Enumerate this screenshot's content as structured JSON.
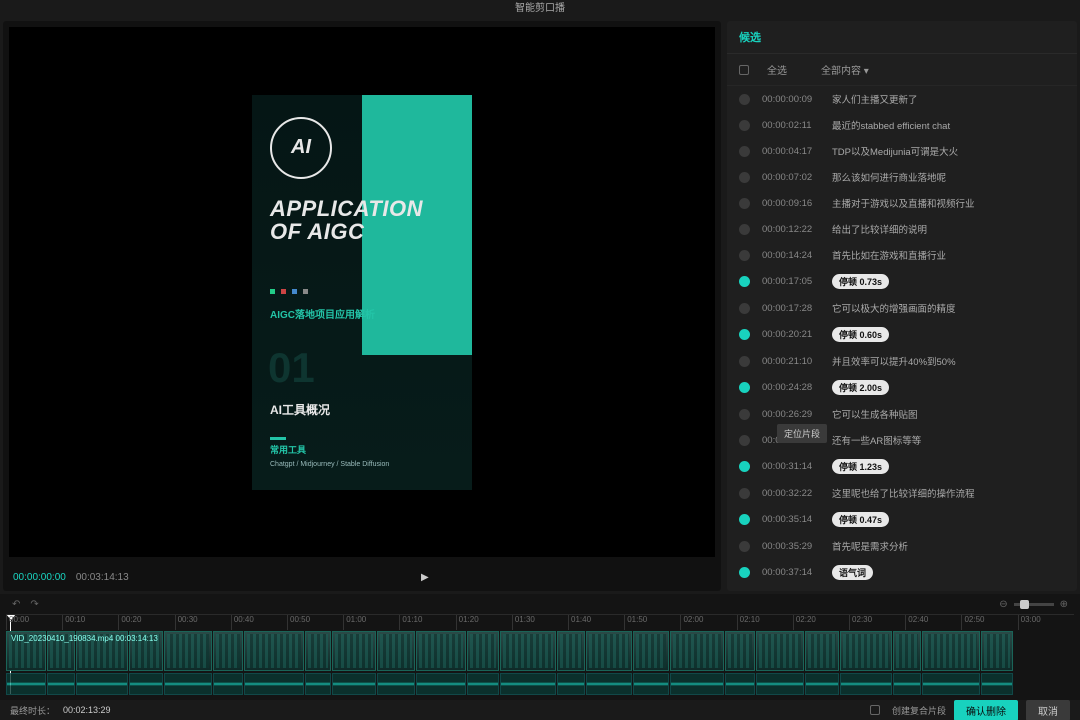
{
  "title": "智能剪口播",
  "preview": {
    "time_current": "00:00:00:00",
    "time_total": "00:03:14:13",
    "slide": {
      "badge": "AI",
      "heading": "APPLICATION OF AIGC",
      "sub1": "AIGC落地项目应用解析",
      "num": "01",
      "sub2": "AI工具概况",
      "sub3": "常用工具",
      "sub4": "Chatgpt / Midjourney / Stable Diffusion"
    }
  },
  "sidebar": {
    "title": "候选",
    "select_all": "全选",
    "filter": "全部内容",
    "tooltip": "定位片段",
    "items": [
      {
        "on": false,
        "ts": "00:00:00:09",
        "txt": "家人们主播又更新了"
      },
      {
        "on": false,
        "ts": "00:00:02:11",
        "txt": "最近的stabbed efficient chat"
      },
      {
        "on": false,
        "ts": "00:00:04:17",
        "txt": "TDP以及Medijunia可谓是大火"
      },
      {
        "on": false,
        "ts": "00:00:07:02",
        "txt": "那么该如何进行商业落地呢"
      },
      {
        "on": false,
        "ts": "00:00:09:16",
        "txt": "主播对于游戏以及直播和视频行业"
      },
      {
        "on": false,
        "ts": "00:00:12:22",
        "txt": "给出了比较详细的说明"
      },
      {
        "on": false,
        "ts": "00:00:14:24",
        "txt": "首先比如在游戏和直播行业"
      },
      {
        "on": true,
        "ts": "00:00:17:05",
        "pill": "停顿 0.73s"
      },
      {
        "on": false,
        "ts": "00:00:17:28",
        "txt": "它可以极大的增强画面的精度"
      },
      {
        "on": true,
        "ts": "00:00:20:21",
        "pill": "停顿 0.60s"
      },
      {
        "on": false,
        "ts": "00:00:21:10",
        "txt": "并且效率可以提升40%到50%"
      },
      {
        "on": true,
        "ts": "00:00:24:28",
        "pill": "停顿 2.00s"
      },
      {
        "on": false,
        "ts": "00:00:26:29",
        "txt": "它可以生成各种贴图"
      },
      {
        "on": false,
        "ts": "00:00:29:06",
        "txt": "还有一些AR图标等等",
        "tip": true
      },
      {
        "on": true,
        "ts": "00:00:31:14",
        "pill": "停顿 1.23s"
      },
      {
        "on": false,
        "ts": "00:00:32:22",
        "txt": "这里呢也给了比较详细的操作流程"
      },
      {
        "on": true,
        "ts": "00:00:35:14",
        "pill": "停顿 0.47s"
      },
      {
        "on": false,
        "ts": "00:00:35:29",
        "txt": "首先呢是需求分析"
      },
      {
        "on": true,
        "ts": "00:00:37:14",
        "pill": "语气词"
      }
    ]
  },
  "timeline": {
    "clip_label": "VID_20230410_190834.mp4   00:03:14:13",
    "ticks": [
      "00:00",
      "00:10",
      "00:20",
      "00:30",
      "00:40",
      "00:50",
      "01:00",
      "01:10",
      "01:20",
      "01:30",
      "01:40",
      "01:50",
      "02:00",
      "02:10",
      "02:20",
      "02:30",
      "02:40",
      "02:50",
      "03:00"
    ],
    "clips_w": [
      40,
      28,
      52,
      34,
      48,
      30,
      60,
      26,
      44,
      38,
      50,
      32,
      56,
      28,
      46,
      36,
      54,
      30,
      48,
      34,
      52,
      28,
      58,
      32
    ],
    "waves_w": [
      40,
      28,
      52,
      34,
      48,
      30,
      60,
      26,
      44,
      38,
      50,
      32,
      56,
      28,
      46,
      36,
      54,
      30,
      48,
      34,
      52,
      28,
      58,
      32
    ]
  },
  "footer": {
    "duration_label": "最终时长：",
    "duration": "00:02:13:29",
    "compound": "创建复合片段",
    "confirm": "确认删除",
    "cancel": "取消"
  }
}
